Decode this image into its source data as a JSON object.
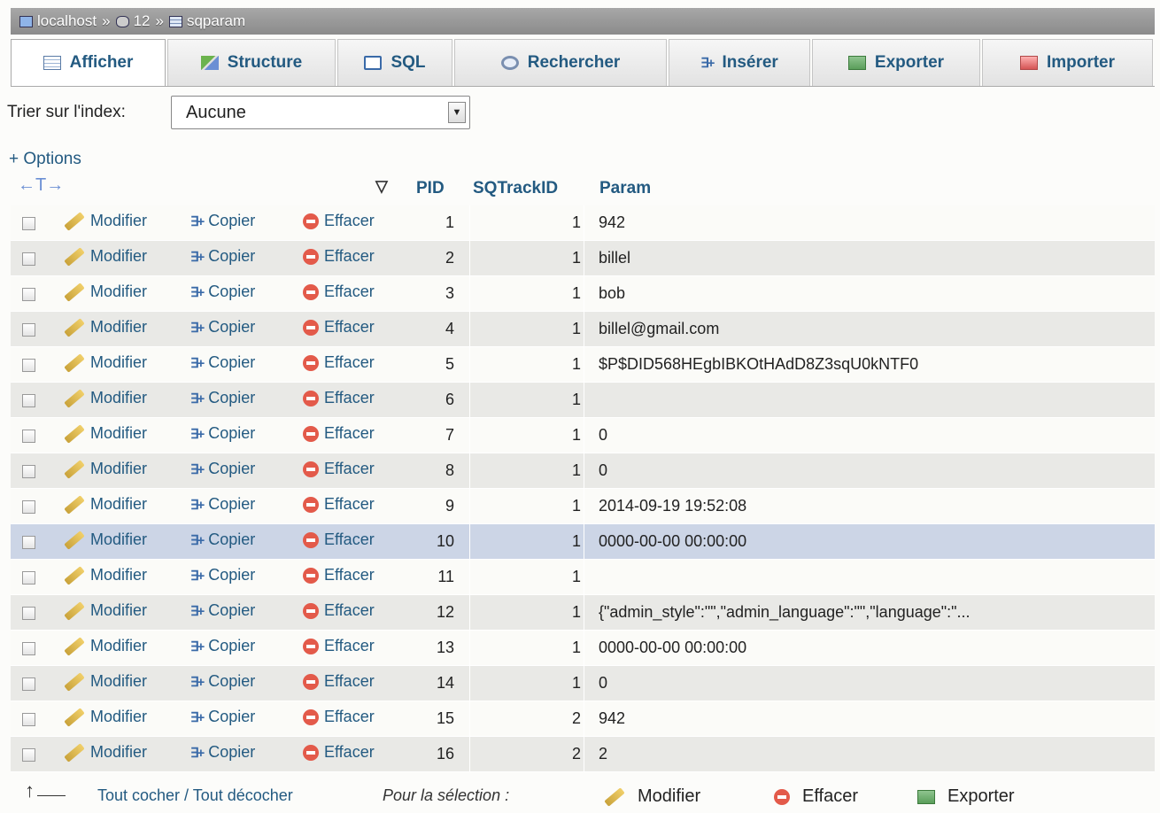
{
  "breadcrumb": {
    "server": "localhost",
    "database": "12",
    "table": "sqparam",
    "separator": "»"
  },
  "tabs": [
    {
      "label": "Afficher",
      "icon": "browse-icon",
      "active": true
    },
    {
      "label": "Structure",
      "icon": "structure-icon"
    },
    {
      "label": "SQL",
      "icon": "sql-icon"
    },
    {
      "label": "Rechercher",
      "icon": "search-icon"
    },
    {
      "label": "Insérer",
      "icon": "insert-icon"
    },
    {
      "label": "Exporter",
      "icon": "export-icon"
    },
    {
      "label": "Importer",
      "icon": "import-icon"
    }
  ],
  "sort": {
    "label": "Trier sur l'index:",
    "selected": "Aucune"
  },
  "options_link": "+ Options",
  "table": {
    "columns": [
      "PID",
      "SQTrackID",
      "Param"
    ],
    "action_labels": {
      "edit": "Modifier",
      "copy": "Copier",
      "delete": "Effacer"
    },
    "rows": [
      {
        "pid": "1",
        "sqtrackid": "1",
        "param": "942"
      },
      {
        "pid": "2",
        "sqtrackid": "1",
        "param": "billel"
      },
      {
        "pid": "3",
        "sqtrackid": "1",
        "param": "bob"
      },
      {
        "pid": "4",
        "sqtrackid": "1",
        "param": "billel@gmail.com"
      },
      {
        "pid": "5",
        "sqtrackid": "1",
        "param": "$P$DID568HEgbIBKOtHAdD8Z3sqU0kNTF0"
      },
      {
        "pid": "6",
        "sqtrackid": "1",
        "param": ""
      },
      {
        "pid": "7",
        "sqtrackid": "1",
        "param": "0"
      },
      {
        "pid": "8",
        "sqtrackid": "1",
        "param": "0"
      },
      {
        "pid": "9",
        "sqtrackid": "1",
        "param": "2014-09-19 19:52:08"
      },
      {
        "pid": "10",
        "sqtrackid": "1",
        "param": "0000-00-00 00:00:00",
        "highlighted": true
      },
      {
        "pid": "11",
        "sqtrackid": "1",
        "param": ""
      },
      {
        "pid": "12",
        "sqtrackid": "1",
        "param": "{\"admin_style\":\"\",\"admin_language\":\"\",\"language\":\"..."
      },
      {
        "pid": "13",
        "sqtrackid": "1",
        "param": "0000-00-00 00:00:00"
      },
      {
        "pid": "14",
        "sqtrackid": "1",
        "param": "0"
      },
      {
        "pid": "15",
        "sqtrackid": "2",
        "param": "942"
      },
      {
        "pid": "16",
        "sqtrackid": "2",
        "param": "2"
      }
    ]
  },
  "footer": {
    "toggle_all": "Tout cocher / Tout décocher",
    "for_selection": "Pour la sélection :",
    "edit": "Modifier",
    "delete": "Effacer",
    "export": "Exporter"
  }
}
